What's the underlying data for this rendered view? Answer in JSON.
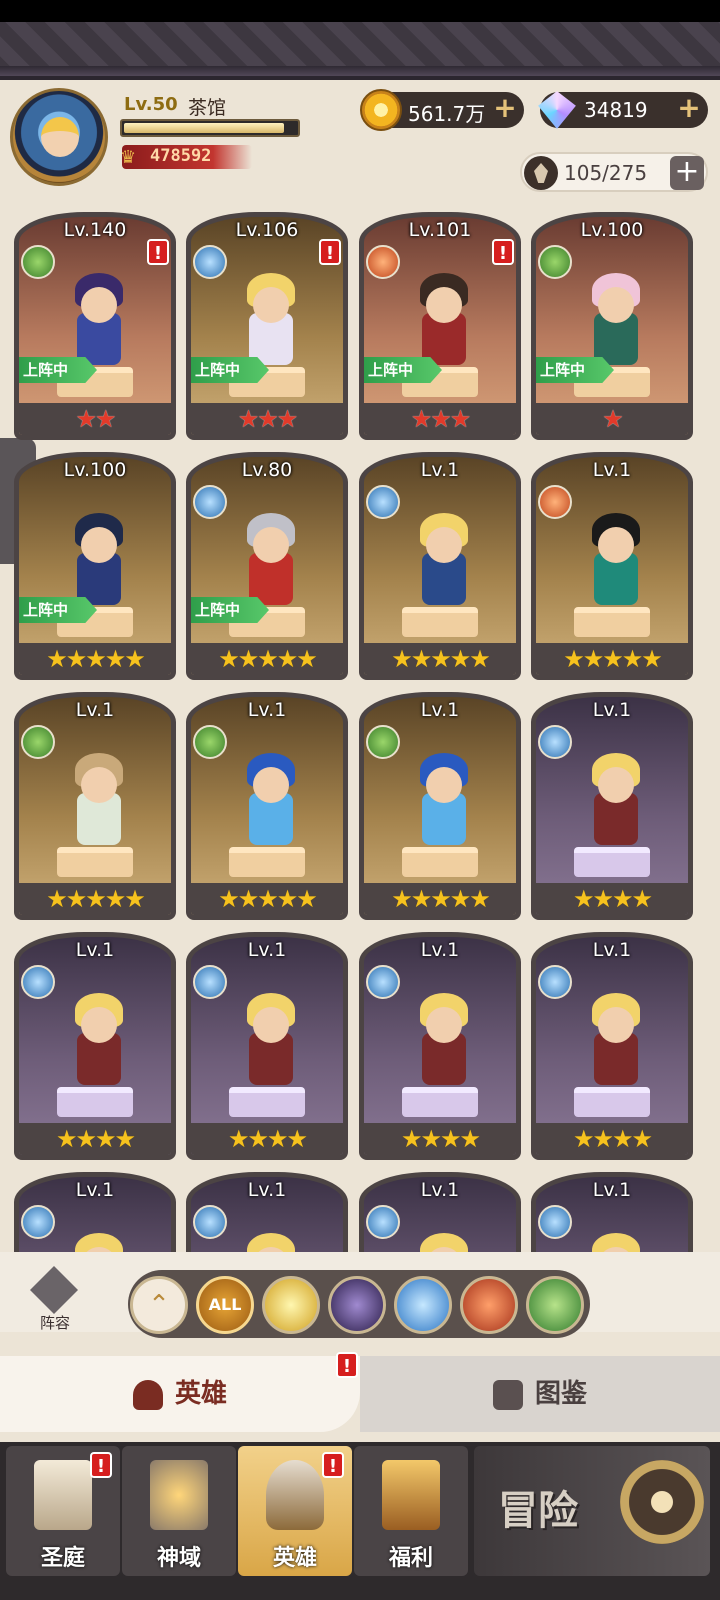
{
  "player": {
    "level": "Lv.50",
    "name": "茶馆",
    "exp_fraction": 0.93,
    "power": "478592"
  },
  "resources": {
    "gold": "561.7万",
    "gems": "34819",
    "hero_slots": "105/275"
  },
  "cards": [
    {
      "level": "Lv.140",
      "faction": "nature",
      "alert": "!",
      "on_team": "上阵中",
      "stars": "★★",
      "star_color": "red"
    },
    {
      "level": "Lv.106",
      "faction": "order",
      "alert": "!",
      "on_team": "上阵中",
      "stars": "★★★",
      "star_color": "red"
    },
    {
      "level": "Lv.101",
      "faction": "beast",
      "alert": "!",
      "on_team": "上阵中",
      "stars": "★★★",
      "star_color": "red"
    },
    {
      "level": "Lv.100",
      "faction": "nature",
      "on_team": "上阵中",
      "stars": "★",
      "star_color": "red"
    },
    {
      "level": "Lv.100",
      "faction": "none",
      "on_team": "上阵中",
      "stars": "★★★★★",
      "star_color": "gold"
    },
    {
      "level": "Lv.80",
      "faction": "order",
      "on_team": "上阵中",
      "stars": "★★★★★",
      "star_color": "gold"
    },
    {
      "level": "Lv.1",
      "faction": "order",
      "stars": "★★★★★",
      "star_color": "gold"
    },
    {
      "level": "Lv.1",
      "faction": "beast",
      "stars": "★★★★★",
      "star_color": "gold"
    },
    {
      "level": "Lv.1",
      "faction": "nature",
      "stars": "★★★★★",
      "star_color": "gold"
    },
    {
      "level": "Lv.1",
      "faction": "nature",
      "stars": "★★★★★",
      "star_color": "gold"
    },
    {
      "level": "Lv.1",
      "faction": "nature",
      "stars": "★★★★★",
      "star_color": "gold"
    },
    {
      "level": "Lv.1",
      "faction": "order",
      "stars": "★★★★",
      "star_color": "gold"
    },
    {
      "level": "Lv.1",
      "faction": "order",
      "stars": "★★★★",
      "star_color": "gold"
    },
    {
      "level": "Lv.1",
      "faction": "order",
      "stars": "★★★★",
      "star_color": "gold"
    },
    {
      "level": "Lv.1",
      "faction": "order",
      "stars": "★★★★",
      "star_color": "gold"
    },
    {
      "level": "Lv.1",
      "faction": "order",
      "stars": "★★★★",
      "star_color": "gold"
    },
    {
      "level": "Lv.1",
      "faction": "order"
    },
    {
      "level": "Lv.1",
      "faction": "order"
    },
    {
      "level": "Lv.1",
      "faction": "order"
    },
    {
      "level": "Lv.1",
      "faction": "order"
    }
  ],
  "filter": {
    "lineup_label": "阵容",
    "all_label": "ALL"
  },
  "tabs": {
    "heroes": "英雄",
    "codex": "图鉴",
    "heroes_alert": "!"
  },
  "nav": {
    "court": "圣庭",
    "realm": "神域",
    "heroes": "英雄",
    "welfare": "福利",
    "adventure": "冒险",
    "alert": "!"
  }
}
